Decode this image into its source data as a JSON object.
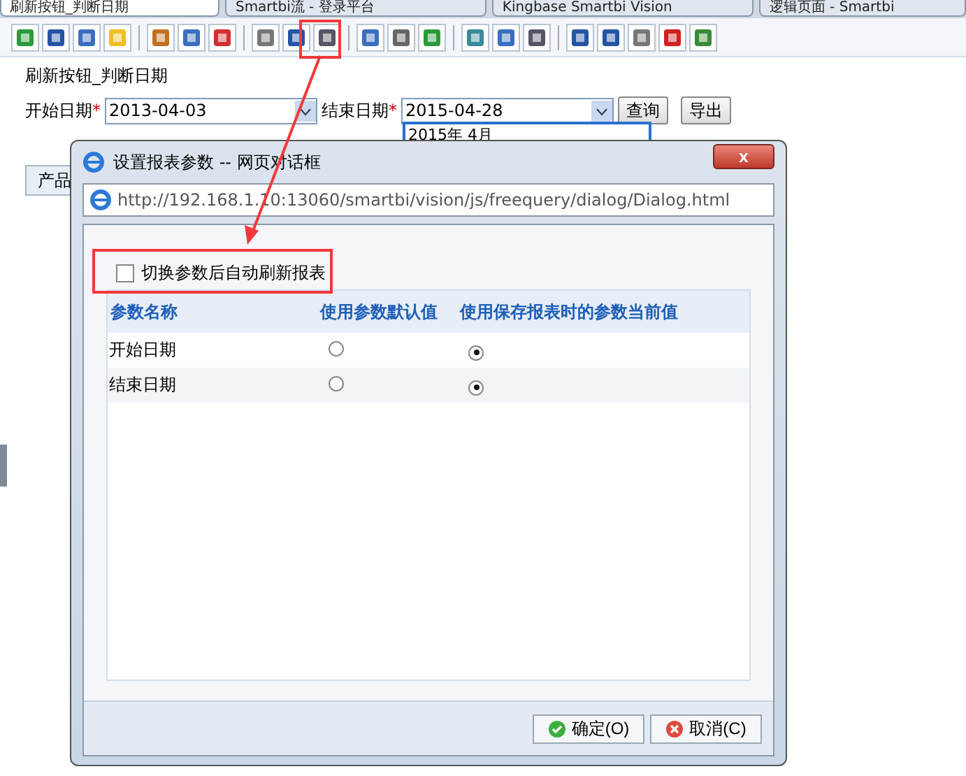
{
  "browser_tabs": [
    {
      "label": "刷新按钮_判断日期",
      "selected": true
    },
    {
      "label": "Smartbi流 - 登录平台",
      "selected": false
    },
    {
      "label": "Kingbase Smartbi Vision",
      "selected": false
    },
    {
      "label": "逻辑页面 - Smartbi",
      "selected": false
    }
  ],
  "report": {
    "title": "刷新按钮_判断日期",
    "start_label": "开始日期",
    "start_value": "2013-04-03",
    "end_label": "结束日期",
    "end_value": "2015-04-28",
    "required_mark": "*",
    "query_button": "查询",
    "export_button": "导出",
    "calendar_header": "2015年 4月",
    "side_tab": "产品"
  },
  "dialog": {
    "title": "设置报表参数 -- 网页对话框",
    "close": "x",
    "url": "http://192.168.1.10:13060/smartbi/vision/js/freequery/dialog/Dialog.html",
    "auto_refresh": {
      "label": "切换参数后自动刷新报表",
      "checked": false
    },
    "columns": [
      "参数名称",
      "使用参数默认值",
      "使用保存报表时的参数当前值"
    ],
    "rows": [
      {
        "name": "开始日期",
        "options": [
          {
            "selected": false
          },
          {
            "selected": true
          }
        ]
      },
      {
        "name": "结束日期",
        "options": [
          {
            "selected": false
          },
          {
            "selected": true
          }
        ]
      }
    ],
    "ok": "确定(O)",
    "cancel": "取消(C)"
  }
}
